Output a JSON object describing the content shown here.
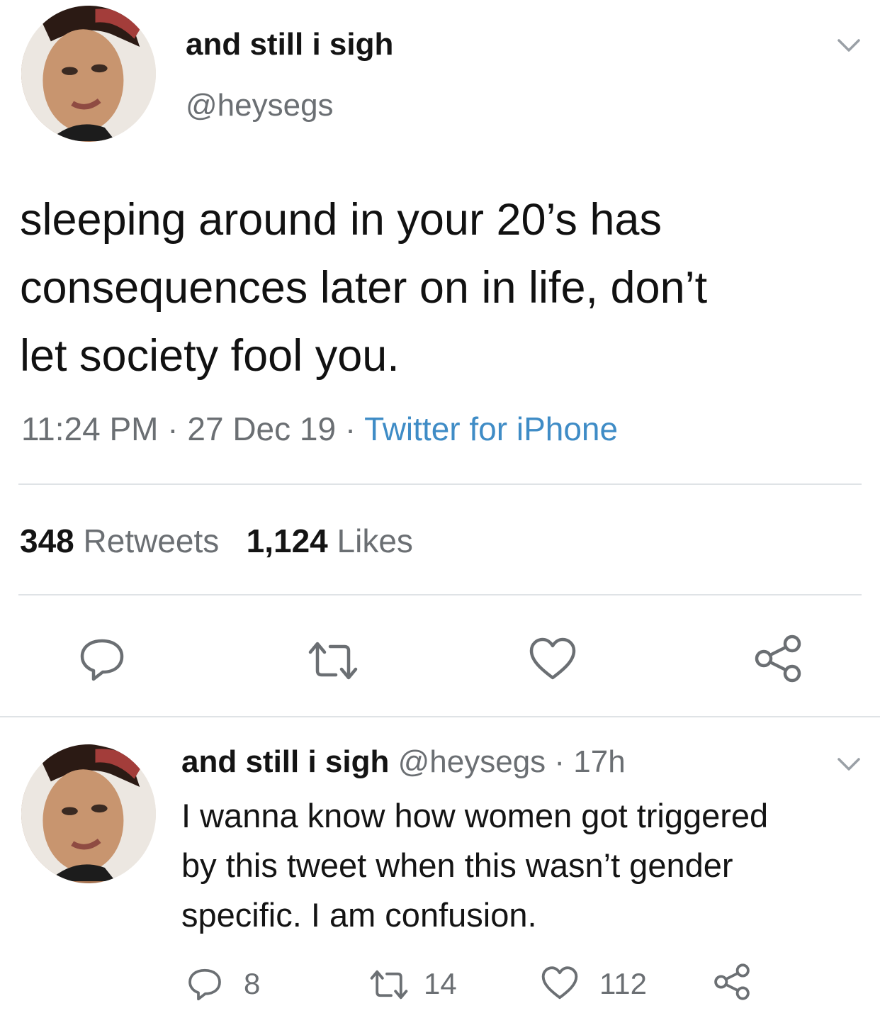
{
  "main_tweet": {
    "display_name": "and still i sigh",
    "handle": "@heysegs",
    "text": "sleeping around in your 20’s has\nconsequences later on in life, don’t\nlet society fool you.",
    "time": "11:24 PM",
    "date": "27 Dec 19",
    "source": "Twitter for iPhone",
    "separator": " · ",
    "retweets": {
      "count": "348",
      "label": "Retweets"
    },
    "likes": {
      "count": "1,124",
      "label": "Likes"
    },
    "actions": [
      "reply-icon",
      "retweet-icon",
      "like-icon",
      "share-icon"
    ]
  },
  "reply_tweet": {
    "display_name": "and still i sigh",
    "handle": "@heysegs",
    "separator": " · ",
    "age": "17h",
    "text": "I wanna know how women got triggered\nby this tweet when this wasn’t gender\nspecific. I am confusion.",
    "reply_count": "8",
    "retweet_count": "14",
    "like_count": "112",
    "actions": [
      "reply-icon",
      "retweet-icon",
      "like-icon",
      "share-icon"
    ]
  },
  "colors": {
    "text": "#141414",
    "secondary": "#6b6f73",
    "link": "#3f8cc6",
    "divider": "#dfe3e6"
  }
}
